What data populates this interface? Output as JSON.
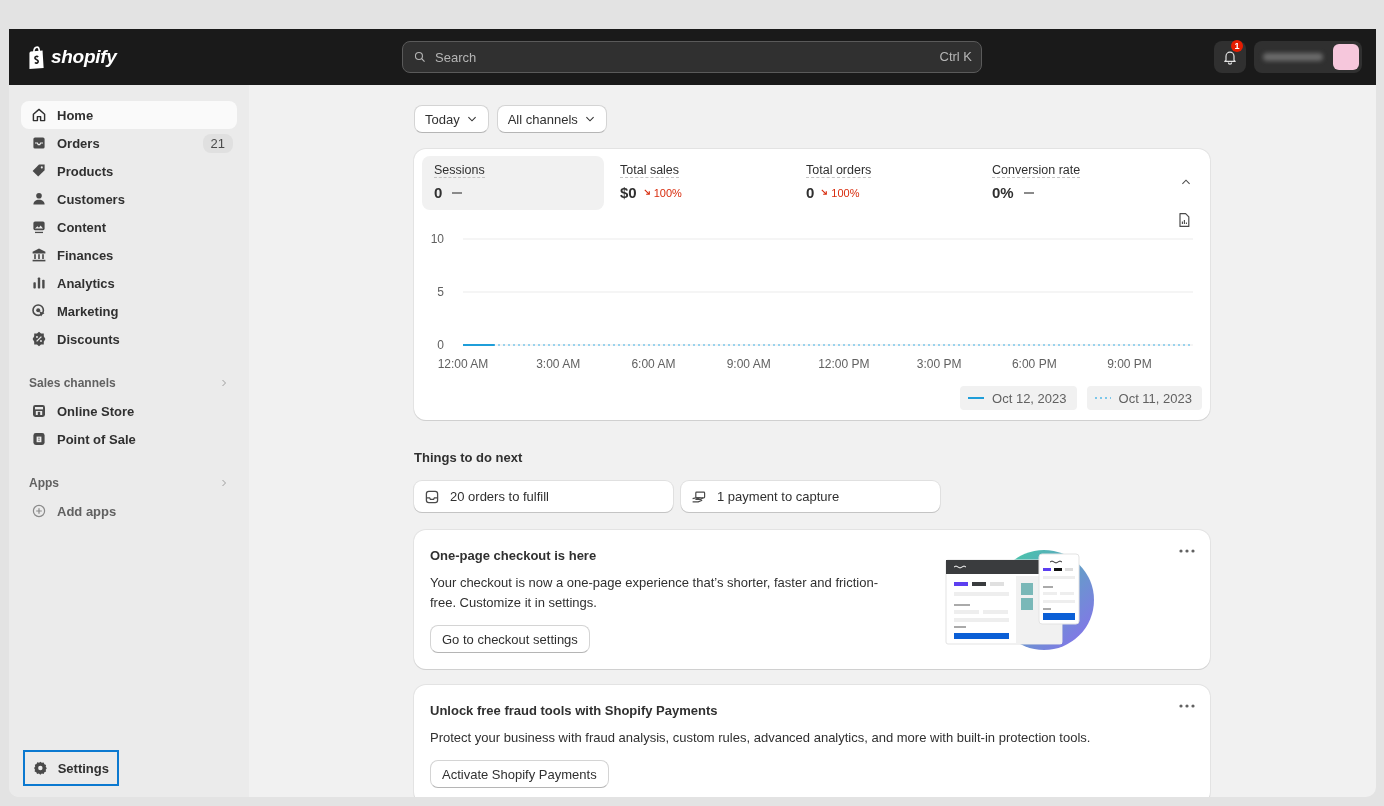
{
  "topbar": {
    "logo": "shopify",
    "search": {
      "placeholder": "Search",
      "shortcut": "Ctrl K"
    },
    "notifications": {
      "count": "1"
    }
  },
  "sidebar": {
    "items": [
      {
        "label": "Home",
        "selected": true
      },
      {
        "label": "Orders",
        "badge": "21",
        "selected": false
      },
      {
        "label": "Products",
        "selected": false
      },
      {
        "label": "Customers",
        "selected": false
      },
      {
        "label": "Content",
        "selected": false
      },
      {
        "label": "Finances",
        "selected": false
      },
      {
        "label": "Analytics",
        "selected": false
      },
      {
        "label": "Marketing",
        "selected": false
      },
      {
        "label": "Discounts",
        "selected": false
      }
    ],
    "sections": [
      {
        "title": "Sales channels",
        "items": [
          {
            "label": "Online Store",
            "kind": "link"
          },
          {
            "label": "Point of Sale",
            "kind": "link"
          }
        ]
      },
      {
        "title": "Apps",
        "items": [
          {
            "label": "Add apps",
            "kind": "action"
          }
        ]
      }
    ],
    "settings": {
      "label": "Settings",
      "focused": true
    }
  },
  "filters": [
    {
      "label": "Today"
    },
    {
      "label": "All channels"
    }
  ],
  "metrics": [
    {
      "label": "Sessions",
      "value": "0",
      "kind": "flat",
      "selected": true
    },
    {
      "label": "Total sales",
      "value": "$0",
      "kind": "down",
      "change": "100%",
      "selected": false
    },
    {
      "label": "Total orders",
      "value": "0",
      "kind": "down",
      "change": "100%",
      "selected": false
    },
    {
      "label": "Conversion rate",
      "value": "0%",
      "kind": "flat",
      "selected": false
    }
  ],
  "chart_data": {
    "type": "line",
    "x": [
      0,
      1,
      2,
      3,
      4,
      5,
      6,
      7,
      8,
      9,
      10,
      11,
      12,
      13,
      14,
      15,
      16,
      17,
      18,
      19,
      20,
      21,
      22,
      23
    ],
    "legend": true,
    "xlim": [
      0,
      23
    ],
    "ylim": [
      0,
      10
    ],
    "yticks": [
      0,
      5,
      10
    ],
    "xticks": [
      {
        "value": 0,
        "label": "12:00 AM"
      },
      {
        "value": 3,
        "label": "3:00 AM"
      },
      {
        "value": 6,
        "label": "6:00 AM"
      },
      {
        "value": 9,
        "label": "9:00 AM"
      },
      {
        "value": 12,
        "label": "12:00 PM"
      },
      {
        "value": 15,
        "label": "3:00 PM"
      },
      {
        "value": 18,
        "label": "6:00 PM"
      },
      {
        "value": 21,
        "label": "9:00 PM"
      }
    ],
    "series": [
      {
        "name": "Oct 12, 2023",
        "color": "#1f9ed9",
        "line_style": "solid",
        "values": [
          0,
          0,
          null,
          null,
          null,
          null,
          null,
          null,
          null,
          null,
          null,
          null,
          null,
          null,
          null,
          null,
          null,
          null,
          null,
          null,
          null,
          null,
          null,
          null
        ]
      },
      {
        "name": "Oct 11, 2023",
        "color": "#7cc7ea",
        "line_style": "dotted",
        "values": [
          0,
          0,
          0,
          0,
          0,
          0,
          0,
          0,
          0,
          0,
          0,
          0,
          0,
          0,
          0,
          0,
          0,
          0,
          0,
          0,
          0,
          0,
          0,
          0
        ]
      }
    ]
  },
  "tasks_title": "Things to do next",
  "tasks": [
    {
      "label": "20 orders to fulfill"
    },
    {
      "label": "1 payment to capture"
    }
  ],
  "cards": [
    {
      "kind": "illustrated",
      "title": "One-page checkout is here",
      "body": "Your checkout is now a one-page experience that’s shorter, faster and friction-free. Customize it in settings.",
      "button": "Go to checkout settings"
    },
    {
      "kind": "plain",
      "title": "Unlock free fraud tools with Shopify Payments",
      "body": "Protect your business with fraud analysis, custom rules, advanced analytics, and more with built-in protection tools.",
      "button": "Activate Shopify Payments"
    }
  ]
}
